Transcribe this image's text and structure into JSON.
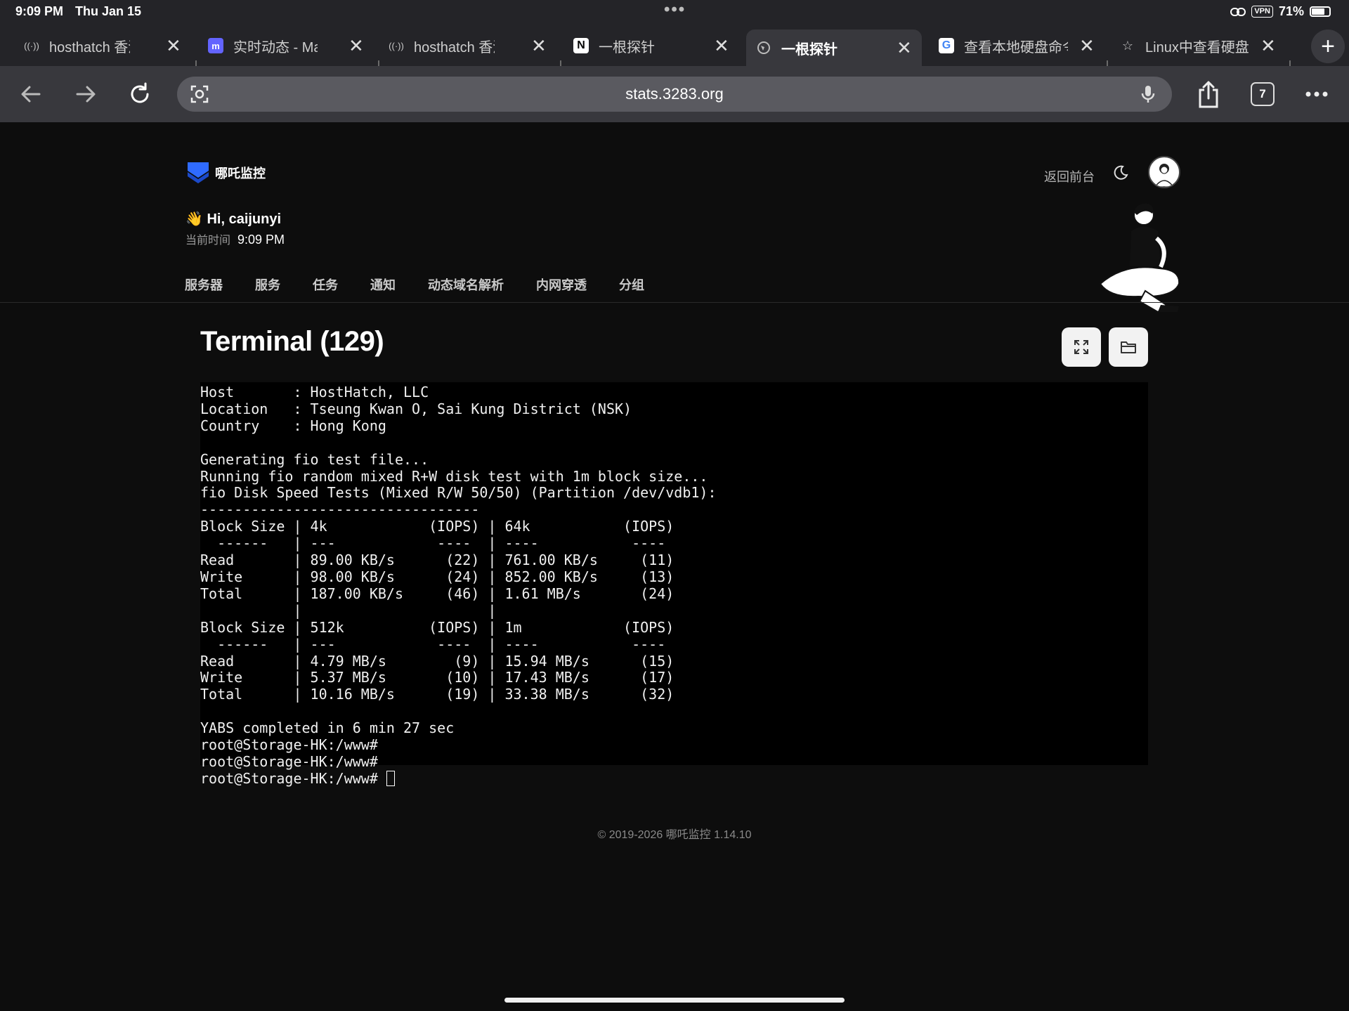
{
  "status_bar": {
    "time": "9:09 PM",
    "date": "Thu Jan 15",
    "vpn": "VPN",
    "battery": "71%",
    "battery_level": 0.71
  },
  "tabs": [
    {
      "icon": "broadcast-icon",
      "label": "hosthatch 香港..."
    },
    {
      "icon": "mastodon-icon",
      "label": "实时动态 - Mastodon"
    },
    {
      "icon": "broadcast-icon",
      "label": "hosthatch 香港..."
    },
    {
      "icon": "notion-icon",
      "label": "一根探针"
    },
    {
      "icon": "globe-icon",
      "label": "一根探针",
      "active": true
    },
    {
      "icon": "google-icon",
      "label": "查看本地硬盘命令"
    },
    {
      "icon": "star-icon",
      "label": "Linux中查看硬盘"
    }
  ],
  "toolbar": {
    "url": "stats.3283.org",
    "tab_count": "7"
  },
  "header": {
    "brand": "哪吒监控",
    "back_link": "返回前台",
    "greeting": "👋 Hi, caijunyi",
    "time_label": "当前时间",
    "time_value": "9:09 PM"
  },
  "nav": [
    "服务器",
    "服务",
    "任务",
    "通知",
    "动态域名解析",
    "内网穿透",
    "分组"
  ],
  "terminal": {
    "title": "Terminal (129)",
    "lines": [
      "Host       : HostHatch, LLC",
      "Location   : Tseung Kwan O, Sai Kung District (NSK)",
      "Country    : Hong Kong",
      "",
      "Generating fio test file...",
      "Running fio random mixed R+W disk test with 1m block size...",
      "fio Disk Speed Tests (Mixed R/W 50/50) (Partition /dev/vdb1):",
      "---------------------------------",
      "Block Size | 4k            (IOPS) | 64k           (IOPS)",
      "  ------   | ---            ----  | ----           ---- ",
      "Read       | 89.00 KB/s      (22) | 761.00 KB/s     (11)",
      "Write      | 98.00 KB/s      (24) | 852.00 KB/s     (13)",
      "Total      | 187.00 KB/s     (46) | 1.61 MB/s       (24)",
      "           |                      |                     ",
      "Block Size | 512k          (IOPS) | 1m            (IOPS)",
      "  ------   | ---            ----  | ----           ---- ",
      "Read       | 4.79 MB/s        (9) | 15.94 MB/s      (15)",
      "Write      | 5.37 MB/s       (10) | 17.43 MB/s      (17)",
      "Total      | 10.16 MB/s      (19) | 33.38 MB/s      (32)",
      "",
      "YABS completed in 6 min 27 sec",
      "root@Storage-HK:/www#",
      "root@Storage-HK:/www#",
      "root@Storage-HK:/www# "
    ]
  },
  "footer": "© 2019-2026 哪吒监控 1.14.10"
}
